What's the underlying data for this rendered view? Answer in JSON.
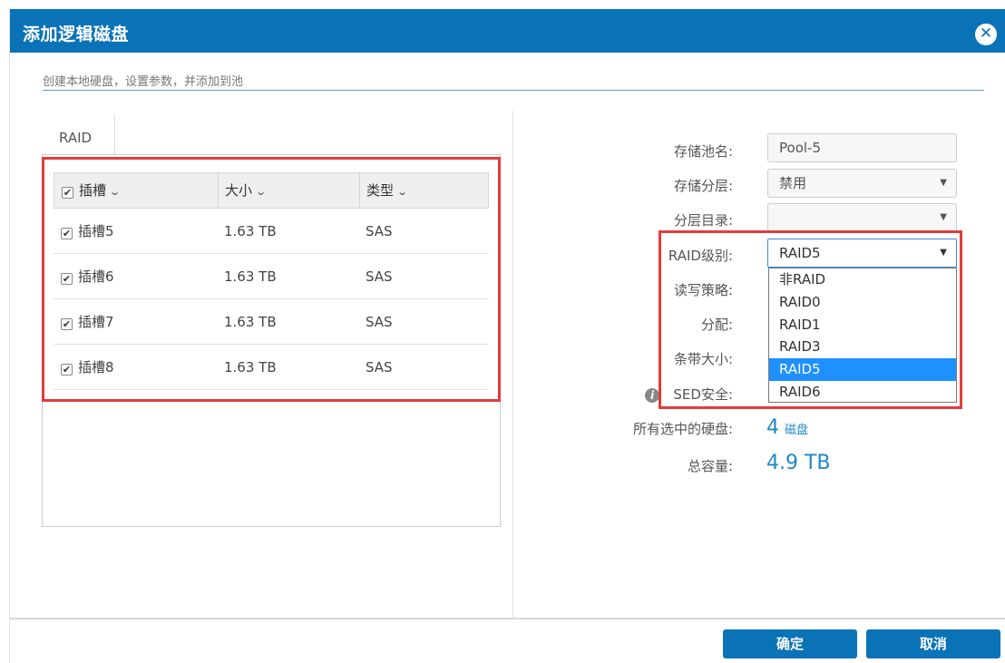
{
  "dialog": {
    "title": "添加逻辑磁盘",
    "close_icon": "close-circle-icon",
    "subtitle": "创建本地硬盘，设置参数，并添加到池"
  },
  "tab": {
    "label": "RAID"
  },
  "table": {
    "headers": [
      "插槽",
      "大小",
      "类型"
    ],
    "rows": [
      {
        "slot": "插槽5",
        "size": "1.63 TB",
        "type": "SAS",
        "checked": true
      },
      {
        "slot": "插槽6",
        "size": "1.63 TB",
        "type": "SAS",
        "checked": true
      },
      {
        "slot": "插槽7",
        "size": "1.63 TB",
        "type": "SAS",
        "checked": true
      },
      {
        "slot": "插槽8",
        "size": "1.63 TB",
        "type": "SAS",
        "checked": true
      }
    ]
  },
  "form": {
    "pool_name_label": "存储池名:",
    "pool_name_value": "Pool-5",
    "tier_label": "存储分层:",
    "tier_value": "禁用",
    "tier_dir_label": "分层目录:",
    "tier_dir_value": "",
    "raid_level_label": "RAID级别:",
    "raid_level_value": "RAID5",
    "rw_policy_label": "读写策略:",
    "alloc_label": "分配:",
    "stripe_label": "条带大小:",
    "sed_label": "SED安全:",
    "selected_disks_label": "所有选中的硬盘:",
    "selected_disks_count": "4",
    "selected_disks_unit": "磁盘",
    "total_capacity_label": "总容量:",
    "total_capacity_value": "4.9 TB"
  },
  "raid_options": [
    "非RAID",
    "RAID0",
    "RAID1",
    "RAID3",
    "RAID5",
    "RAID6"
  ],
  "raid_selected": "RAID5",
  "buttons": {
    "ok": "确定",
    "cancel": "取消"
  },
  "colors": {
    "titlebar": "#0a73b7",
    "accent_text": "#1e88c7",
    "selected_option": "#1e90ff",
    "highlight_box": "#e33b3b"
  }
}
